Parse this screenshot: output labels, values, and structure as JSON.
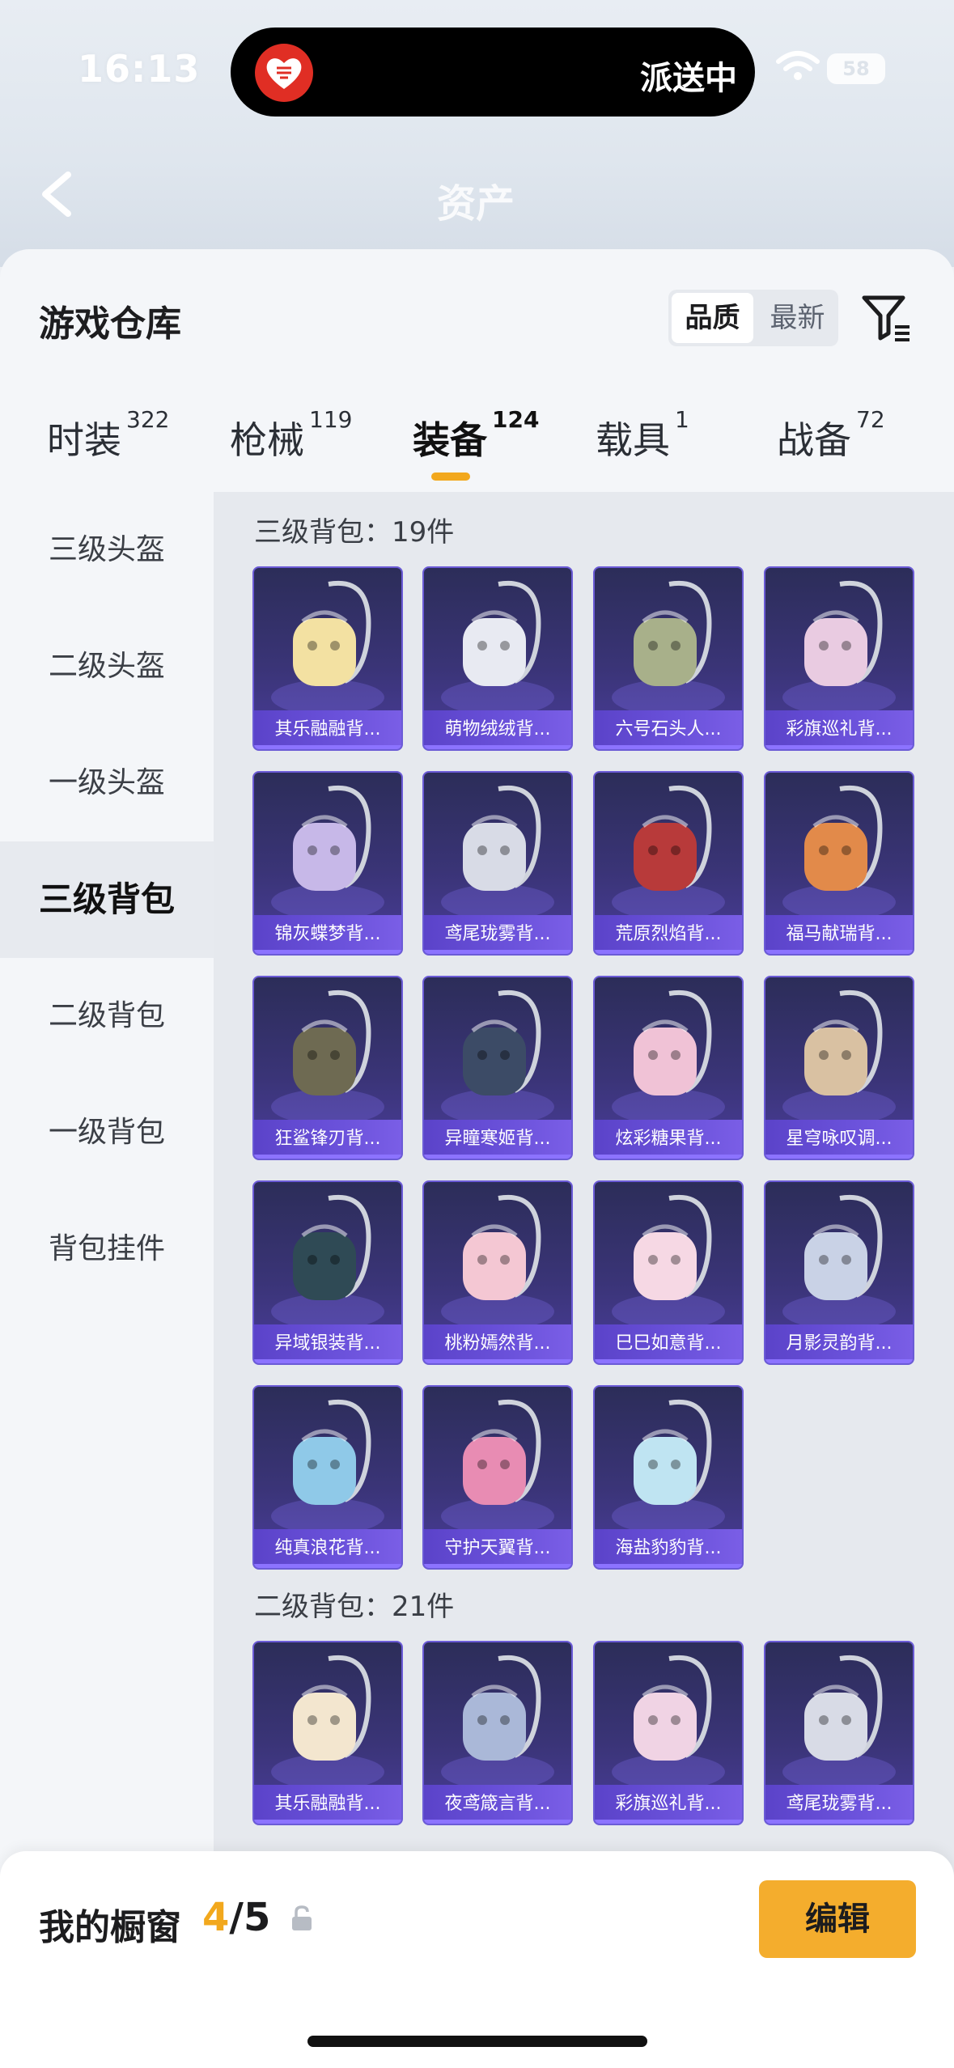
{
  "status_bar": {
    "time": "16:13",
    "island_text": "派送中",
    "battery": "58"
  },
  "header": {
    "title": "资产"
  },
  "sheet": {
    "title": "游戏仓库",
    "sort_options": [
      "品质",
      "最新"
    ],
    "sort_selected": "品质"
  },
  "tabs": [
    {
      "label": "时装",
      "count": "322"
    },
    {
      "label": "枪械",
      "count": "119"
    },
    {
      "label": "装备",
      "count": "124",
      "active": true
    },
    {
      "label": "载具",
      "count": "1"
    },
    {
      "label": "战备",
      "count": "72"
    }
  ],
  "sidebar": [
    {
      "label": "三级头盔"
    },
    {
      "label": "二级头盔"
    },
    {
      "label": "一级头盔"
    },
    {
      "label": "三级背包",
      "active": true
    },
    {
      "label": "二级背包"
    },
    {
      "label": "一级背包"
    },
    {
      "label": "背包挂件"
    }
  ],
  "sections": [
    {
      "title": "三级背包：19件",
      "items": [
        {
          "name": "其乐融融背...",
          "art": "cupcake-bunny-backpack"
        },
        {
          "name": "萌物绒绒背...",
          "art": "fluffy-bunny-backpack"
        },
        {
          "name": "六号石头人...",
          "art": "stone-golem-backpack"
        },
        {
          "name": "彩旗巡礼背...",
          "art": "festival-drum-backpack"
        },
        {
          "name": "锦灰蝶梦背...",
          "art": "butterfly-dream-backpack"
        },
        {
          "name": "鸢尾珑雾背...",
          "art": "iris-mist-backpack"
        },
        {
          "name": "荒原烈焰背...",
          "art": "wasteland-flame-backpack"
        },
        {
          "name": "福马献瑞背...",
          "art": "lucky-horse-backpack"
        },
        {
          "name": "狂鲨锋刃背...",
          "art": "shark-blade-backpack"
        },
        {
          "name": "异瞳寒姬背...",
          "art": "odd-eye-bunny-backpack"
        },
        {
          "name": "炫彩糖果背...",
          "art": "candy-donut-backpack"
        },
        {
          "name": "星穹咏叹调...",
          "art": "starry-aria-backpack"
        },
        {
          "name": "异域银装背...",
          "art": "exotic-silver-backpack"
        },
        {
          "name": "桃粉嫣然背...",
          "art": "peach-blossom-backpack"
        },
        {
          "name": "巳巳如意背...",
          "art": "snake-ruyi-backpack"
        },
        {
          "name": "月影灵韵背...",
          "art": "moon-shadow-backpack"
        },
        {
          "name": "纯真浪花背...",
          "art": "wave-drink-backpack"
        },
        {
          "name": "守护天翼背...",
          "art": "guardian-wing-backpack"
        },
        {
          "name": "海盐豹豹背...",
          "art": "sea-salt-seal-backpack"
        }
      ]
    },
    {
      "title": "二级背包：21件",
      "items": [
        {
          "name": "其乐融融背...",
          "art": "cupcake-backpack"
        },
        {
          "name": "夜鸢箴言背...",
          "art": "night-kite-backpack"
        },
        {
          "name": "彩旗巡礼背...",
          "art": "festival-drum-backpack"
        },
        {
          "name": "鸢尾珑雾背...",
          "art": "iris-mist-backpack"
        }
      ]
    }
  ],
  "bottom_bar": {
    "title": "我的橱窗",
    "current": "4",
    "total": "/5",
    "edit_label": "编辑"
  },
  "colors": {
    "accent": "#f4ad2d",
    "card_top": "#2c2d59",
    "card_bottom": "#4a3d9b",
    "label_bg": "#6b52db"
  }
}
